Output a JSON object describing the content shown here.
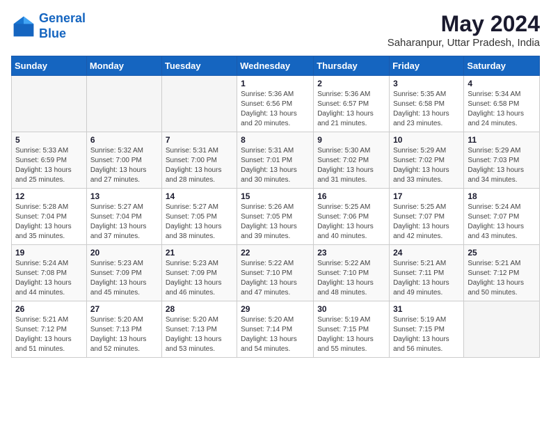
{
  "logo": {
    "line1": "General",
    "line2": "Blue"
  },
  "title": "May 2024",
  "subtitle": "Saharanpur, Uttar Pradesh, India",
  "days_of_week": [
    "Sunday",
    "Monday",
    "Tuesday",
    "Wednesday",
    "Thursday",
    "Friday",
    "Saturday"
  ],
  "weeks": [
    [
      {
        "day": "",
        "info": ""
      },
      {
        "day": "",
        "info": ""
      },
      {
        "day": "",
        "info": ""
      },
      {
        "day": "1",
        "info": "Sunrise: 5:36 AM\nSunset: 6:56 PM\nDaylight: 13 hours\nand 20 minutes."
      },
      {
        "day": "2",
        "info": "Sunrise: 5:36 AM\nSunset: 6:57 PM\nDaylight: 13 hours\nand 21 minutes."
      },
      {
        "day": "3",
        "info": "Sunrise: 5:35 AM\nSunset: 6:58 PM\nDaylight: 13 hours\nand 23 minutes."
      },
      {
        "day": "4",
        "info": "Sunrise: 5:34 AM\nSunset: 6:58 PM\nDaylight: 13 hours\nand 24 minutes."
      }
    ],
    [
      {
        "day": "5",
        "info": "Sunrise: 5:33 AM\nSunset: 6:59 PM\nDaylight: 13 hours\nand 25 minutes."
      },
      {
        "day": "6",
        "info": "Sunrise: 5:32 AM\nSunset: 7:00 PM\nDaylight: 13 hours\nand 27 minutes."
      },
      {
        "day": "7",
        "info": "Sunrise: 5:31 AM\nSunset: 7:00 PM\nDaylight: 13 hours\nand 28 minutes."
      },
      {
        "day": "8",
        "info": "Sunrise: 5:31 AM\nSunset: 7:01 PM\nDaylight: 13 hours\nand 30 minutes."
      },
      {
        "day": "9",
        "info": "Sunrise: 5:30 AM\nSunset: 7:02 PM\nDaylight: 13 hours\nand 31 minutes."
      },
      {
        "day": "10",
        "info": "Sunrise: 5:29 AM\nSunset: 7:02 PM\nDaylight: 13 hours\nand 33 minutes."
      },
      {
        "day": "11",
        "info": "Sunrise: 5:29 AM\nSunset: 7:03 PM\nDaylight: 13 hours\nand 34 minutes."
      }
    ],
    [
      {
        "day": "12",
        "info": "Sunrise: 5:28 AM\nSunset: 7:04 PM\nDaylight: 13 hours\nand 35 minutes."
      },
      {
        "day": "13",
        "info": "Sunrise: 5:27 AM\nSunset: 7:04 PM\nDaylight: 13 hours\nand 37 minutes."
      },
      {
        "day": "14",
        "info": "Sunrise: 5:27 AM\nSunset: 7:05 PM\nDaylight: 13 hours\nand 38 minutes."
      },
      {
        "day": "15",
        "info": "Sunrise: 5:26 AM\nSunset: 7:05 PM\nDaylight: 13 hours\nand 39 minutes."
      },
      {
        "day": "16",
        "info": "Sunrise: 5:25 AM\nSunset: 7:06 PM\nDaylight: 13 hours\nand 40 minutes."
      },
      {
        "day": "17",
        "info": "Sunrise: 5:25 AM\nSunset: 7:07 PM\nDaylight: 13 hours\nand 42 minutes."
      },
      {
        "day": "18",
        "info": "Sunrise: 5:24 AM\nSunset: 7:07 PM\nDaylight: 13 hours\nand 43 minutes."
      }
    ],
    [
      {
        "day": "19",
        "info": "Sunrise: 5:24 AM\nSunset: 7:08 PM\nDaylight: 13 hours\nand 44 minutes."
      },
      {
        "day": "20",
        "info": "Sunrise: 5:23 AM\nSunset: 7:09 PM\nDaylight: 13 hours\nand 45 minutes."
      },
      {
        "day": "21",
        "info": "Sunrise: 5:23 AM\nSunset: 7:09 PM\nDaylight: 13 hours\nand 46 minutes."
      },
      {
        "day": "22",
        "info": "Sunrise: 5:22 AM\nSunset: 7:10 PM\nDaylight: 13 hours\nand 47 minutes."
      },
      {
        "day": "23",
        "info": "Sunrise: 5:22 AM\nSunset: 7:10 PM\nDaylight: 13 hours\nand 48 minutes."
      },
      {
        "day": "24",
        "info": "Sunrise: 5:21 AM\nSunset: 7:11 PM\nDaylight: 13 hours\nand 49 minutes."
      },
      {
        "day": "25",
        "info": "Sunrise: 5:21 AM\nSunset: 7:12 PM\nDaylight: 13 hours\nand 50 minutes."
      }
    ],
    [
      {
        "day": "26",
        "info": "Sunrise: 5:21 AM\nSunset: 7:12 PM\nDaylight: 13 hours\nand 51 minutes."
      },
      {
        "day": "27",
        "info": "Sunrise: 5:20 AM\nSunset: 7:13 PM\nDaylight: 13 hours\nand 52 minutes."
      },
      {
        "day": "28",
        "info": "Sunrise: 5:20 AM\nSunset: 7:13 PM\nDaylight: 13 hours\nand 53 minutes."
      },
      {
        "day": "29",
        "info": "Sunrise: 5:20 AM\nSunset: 7:14 PM\nDaylight: 13 hours\nand 54 minutes."
      },
      {
        "day": "30",
        "info": "Sunrise: 5:19 AM\nSunset: 7:15 PM\nDaylight: 13 hours\nand 55 minutes."
      },
      {
        "day": "31",
        "info": "Sunrise: 5:19 AM\nSunset: 7:15 PM\nDaylight: 13 hours\nand 56 minutes."
      },
      {
        "day": "",
        "info": ""
      }
    ]
  ]
}
